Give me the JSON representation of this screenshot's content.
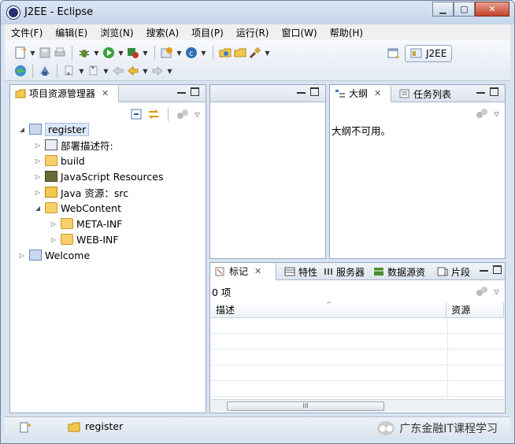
{
  "window": {
    "title": "J2EE - Eclipse"
  },
  "menu": [
    "文件(F)",
    "编辑(E)",
    "浏览(N)",
    "搜索(A)",
    "项目(P)",
    "运行(R)",
    "窗口(W)",
    "帮助(H)"
  ],
  "perspective": {
    "label": "J2EE"
  },
  "project_explorer": {
    "tab_label": "项目资源管理器",
    "tree": [
      {
        "label": "register",
        "depth": 0,
        "expanded": true,
        "icon": "project-icon"
      },
      {
        "label": "部署描述符:",
        "depth": 1,
        "expanded": false,
        "icon": "deploy-descriptor-icon"
      },
      {
        "label": "build",
        "depth": 1,
        "expanded": false,
        "icon": "folder-icon"
      },
      {
        "label": "JavaScript Resources",
        "depth": 1,
        "expanded": false,
        "icon": "js-resources-icon"
      },
      {
        "label": "Java 资源：src",
        "depth": 1,
        "expanded": false,
        "icon": "java-resources-icon"
      },
      {
        "label": "WebContent",
        "depth": 1,
        "expanded": true,
        "icon": "folder-icon"
      },
      {
        "label": "META-INF",
        "depth": 2,
        "expanded": false,
        "icon": "folder-icon"
      },
      {
        "label": "WEB-INF",
        "depth": 2,
        "expanded": false,
        "icon": "folder-icon"
      },
      {
        "label": "Welcome",
        "depth": 0,
        "expanded": false,
        "icon": "project-icon"
      }
    ]
  },
  "outline": {
    "tabs": [
      "大纲",
      "任务列表"
    ],
    "message": "大纲不可用。"
  },
  "bottom_panel": {
    "tabs": [
      "标记",
      "特性",
      "服务器",
      "数据源资",
      "片段"
    ],
    "count": "0 项",
    "columns": [
      "描述",
      "资源"
    ]
  },
  "status": {
    "selected": "register"
  },
  "watermark": {
    "text": "广东金融IT课程学习"
  }
}
